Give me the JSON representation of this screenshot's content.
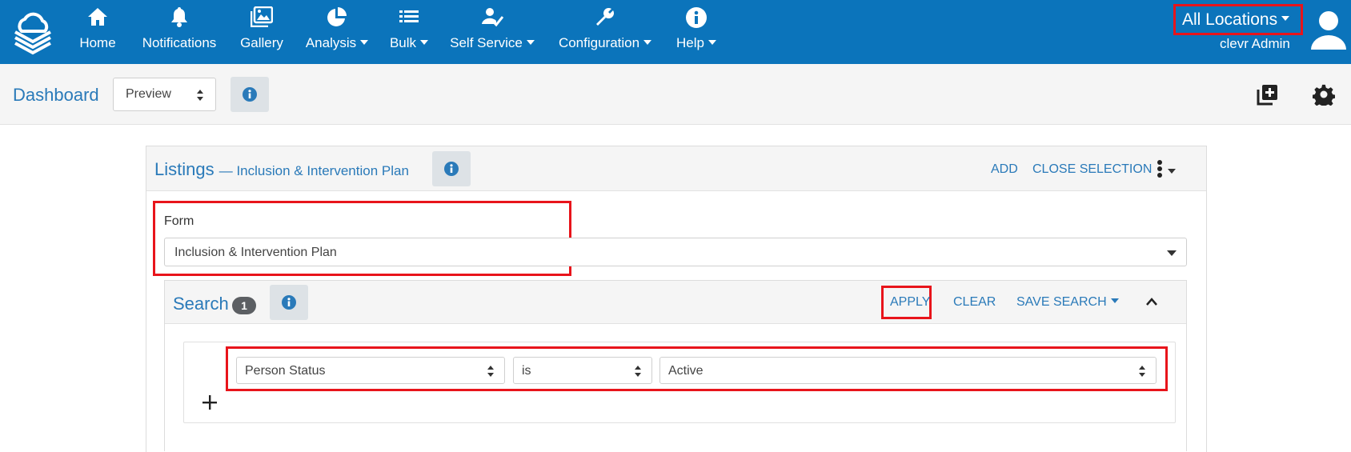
{
  "nav": {
    "items": [
      {
        "label": "Home",
        "icon": "home-icon",
        "dropdown": false
      },
      {
        "label": "Notifications",
        "icon": "bell-icon",
        "dropdown": false
      },
      {
        "label": "Gallery",
        "icon": "gallery-icon",
        "dropdown": false
      },
      {
        "label": "Analysis",
        "icon": "pie-chart-icon",
        "dropdown": true
      },
      {
        "label": "Bulk",
        "icon": "list-icon",
        "dropdown": true
      },
      {
        "label": "Self Service",
        "icon": "user-check-icon",
        "dropdown": true
      },
      {
        "label": "Configuration",
        "icon": "wrench-icon",
        "dropdown": true
      },
      {
        "label": "Help",
        "icon": "info-icon",
        "dropdown": true
      }
    ],
    "location": "All Locations",
    "user_name": "clevr Admin"
  },
  "dashboard": {
    "title": "Dashboard",
    "view_select": "Preview"
  },
  "listings": {
    "title": "Listings",
    "subtitle": "— Inclusion & Intervention Plan",
    "actions": {
      "add": "ADD",
      "close_selection": "CLOSE SELECTION"
    },
    "form_label": "Form",
    "form_value": "Inclusion & Intervention Plan"
  },
  "search": {
    "title": "Search",
    "count": "1",
    "actions": {
      "apply": "APPLY",
      "clear": "CLEAR",
      "save_search": "SAVE SEARCH"
    },
    "criterion": {
      "field": "Person Status",
      "operator": "is",
      "value": "Active"
    }
  },
  "colors": {
    "nav_bg": "#0b74bb",
    "link": "#2a7ab9",
    "highlight": "#e8141b"
  }
}
